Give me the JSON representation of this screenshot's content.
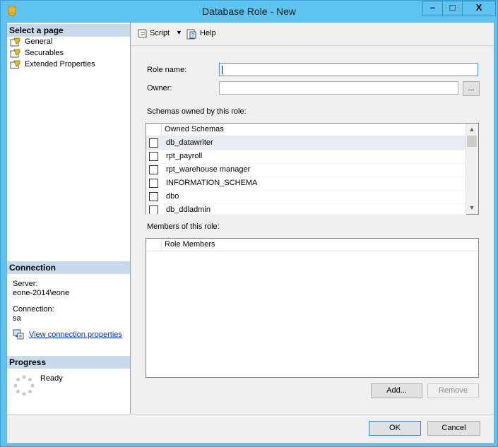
{
  "window": {
    "title": "Database Role - New",
    "minimize_glyph": "–",
    "maximize_glyph": "□",
    "close_glyph": "X"
  },
  "left_pane": {
    "select_page_header": "Select a page",
    "pages": [
      {
        "label": "General",
        "icon": "page-icon"
      },
      {
        "label": "Securables",
        "icon": "page-icon"
      },
      {
        "label": "Extended Properties",
        "icon": "page-icon"
      }
    ],
    "connection_header": "Connection",
    "server_label": "Server:",
    "server_value": "eone-2014\\eone",
    "connection_label": "Connection:",
    "connection_value": "sa",
    "view_connection_link": "View connection properties",
    "progress_header": "Progress",
    "progress_status": "Ready"
  },
  "toolbar": {
    "script_label": "Script",
    "help_label": "Help"
  },
  "form": {
    "role_name_label": "Role name:",
    "role_name_value": "",
    "owner_label": "Owner:",
    "owner_value": "",
    "browse_label": "...",
    "schemas_label": "Schemas owned by this role:",
    "schemas_column_header": "Owned Schemas",
    "schemas": [
      {
        "name": "db_datawriter",
        "checked": false,
        "selected": true
      },
      {
        "name": "rpt_payroll",
        "checked": false,
        "selected": false
      },
      {
        "name": "rpt_warehouse manager",
        "checked": false,
        "selected": false
      },
      {
        "name": "INFORMATION_SCHEMA",
        "checked": false,
        "selected": false
      },
      {
        "name": "dbo",
        "checked": false,
        "selected": false
      },
      {
        "name": "db_ddladmin",
        "checked": false,
        "selected": false
      }
    ],
    "members_label": "Members of this role:",
    "members_column_header": "Role Members",
    "add_label": "Add...",
    "remove_label": "Remove"
  },
  "footer": {
    "ok_label": "OK",
    "cancel_label": "Cancel"
  },
  "colors": {
    "titlebar": "#5ec3ef",
    "section_header": "#c8d9ea",
    "selection": "#e8edf3",
    "link": "#0033cc"
  }
}
